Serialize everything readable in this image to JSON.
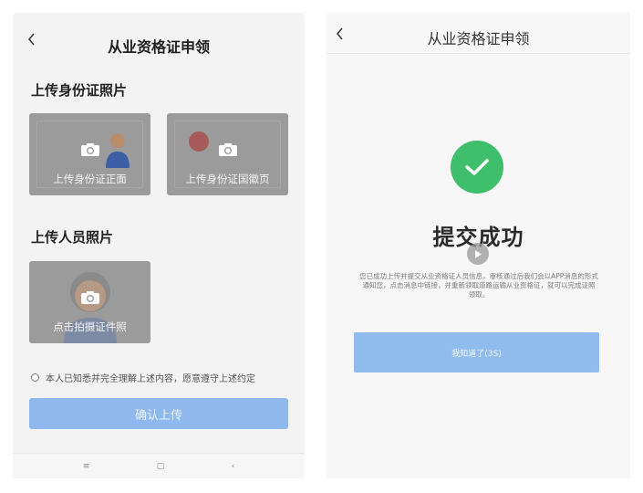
{
  "left_screen": {
    "title": "从业资格证申领",
    "back_icon": "chevron-left-icon",
    "id_section": {
      "heading": "上传身份证照片",
      "front_caption": "上传身份证正面",
      "back_caption": "上传身份证国徽页"
    },
    "person_section": {
      "heading": "上传人员照片",
      "photo_caption": "点击拍摄证件照"
    },
    "agreement_text": "本人已知悉并完全理解上述内容，愿意遵守上述约定",
    "confirm_button": "确认上传",
    "nav": {
      "menu": "≡",
      "home": "▢",
      "back": "‹"
    }
  },
  "right_screen": {
    "title": "从业资格证申领",
    "back_icon": "chevron-left-icon",
    "success_icon": "check-circle-icon",
    "success_title": "提交成功",
    "description": "您已成功上传并提交从业资格证人员信息，审核通过后我们会以APP消息的形式通知您，点击消息中链接，并重新领取道路运输从业资格证，就可以完成证照领取。",
    "ok_button": "我知道了(3S)"
  },
  "colors": {
    "primary_button": "#8fb9ee",
    "success_green": "#3fbf6b",
    "card_overlay": "#9b9b9b"
  }
}
